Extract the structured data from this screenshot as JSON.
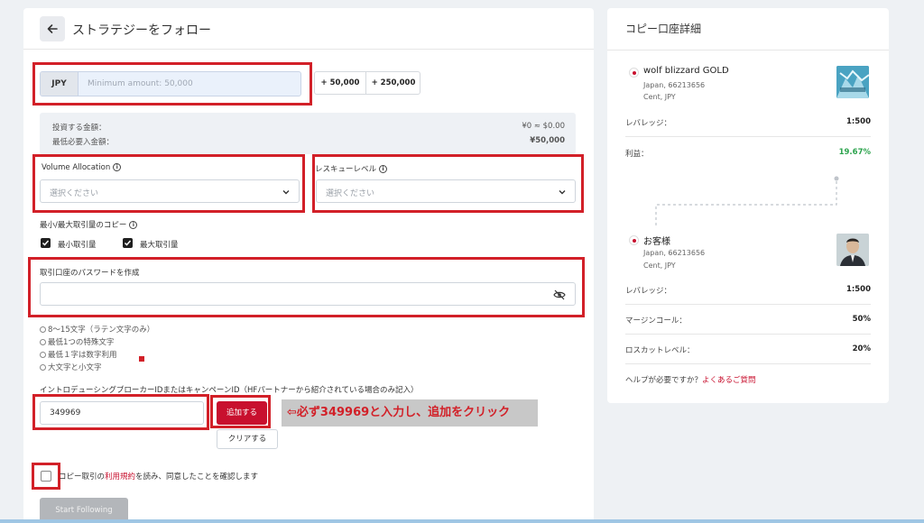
{
  "header": {
    "title": "ストラテジーをフォロー"
  },
  "amount": {
    "currency": "JPY",
    "placeholder": "Minimum amount: 50,000",
    "quick_buttons": [
      "+ 50,000",
      "+ 250,000"
    ]
  },
  "summary": {
    "invest_label": "投資する金額：",
    "invest_value": "¥0 ≈ $0.00",
    "min_label": "最低必要入金額：",
    "min_value": "¥50,000"
  },
  "volume_allocation": {
    "label": "Volume Allocation",
    "placeholder": "選択ください"
  },
  "rescue_level": {
    "label": "レスキューレベル",
    "placeholder": "選択ください"
  },
  "copy_size": {
    "label": "最小/最大取引量のコピー",
    "min_label": "最小取引量",
    "max_label": "最大取引量"
  },
  "password": {
    "label": "取引口座のパスワードを作成",
    "rules": [
      "8～15文字（ラテン文字のみ）",
      "最低1つの特殊文字",
      "最低１字は数字利用",
      "大文字と小文字"
    ]
  },
  "ib": {
    "label": "イントロデューシングブローカーIDまたはキャンペーンID（HFパートナーから紹介されている場合のみ記入）",
    "value": "349969",
    "add_label": "追加する",
    "clear_label": "クリアする"
  },
  "annotation": "⇦必ず349969と入力し、追加をクリック",
  "agreement": {
    "prefix": "コピー取引の",
    "link": "利用規約",
    "suffix": "を読み、同意したことを確認します"
  },
  "start_button": "Start Following",
  "copy_details": {
    "title": "コピー口座詳細",
    "strategy": {
      "name": "wolf blizzard GOLD",
      "location": "Japan, 66213656",
      "account_type": "Cent, JPY"
    },
    "strategy_rows": [
      {
        "label": "レバレッジ：",
        "value": "1:500"
      },
      {
        "label": "利益：",
        "value": "19.67%"
      }
    ],
    "customer": {
      "name": "お客様",
      "location": "Japan, 66213656",
      "account_type": "Cent, JPY"
    },
    "customer_rows": [
      {
        "label": "レバレッジ：",
        "value": "1:500"
      },
      {
        "label": "マージンコール：",
        "value": "50%"
      },
      {
        "label": "ロスカットレベル：",
        "value": "20%"
      }
    ],
    "help_text": "ヘルプが必要ですか？",
    "help_link": "よくあるご質問"
  },
  "colors": {
    "accent_red": "#c8102e",
    "highlight_red": "#d22028",
    "profit_green": "#2da44e",
    "disabled_gray": "#b3b6ba"
  },
  "icons": [
    "arrow-left-icon",
    "info-icon",
    "chevron-down-icon",
    "check-icon",
    "eye-off-icon",
    "japan-flag-icon"
  ]
}
